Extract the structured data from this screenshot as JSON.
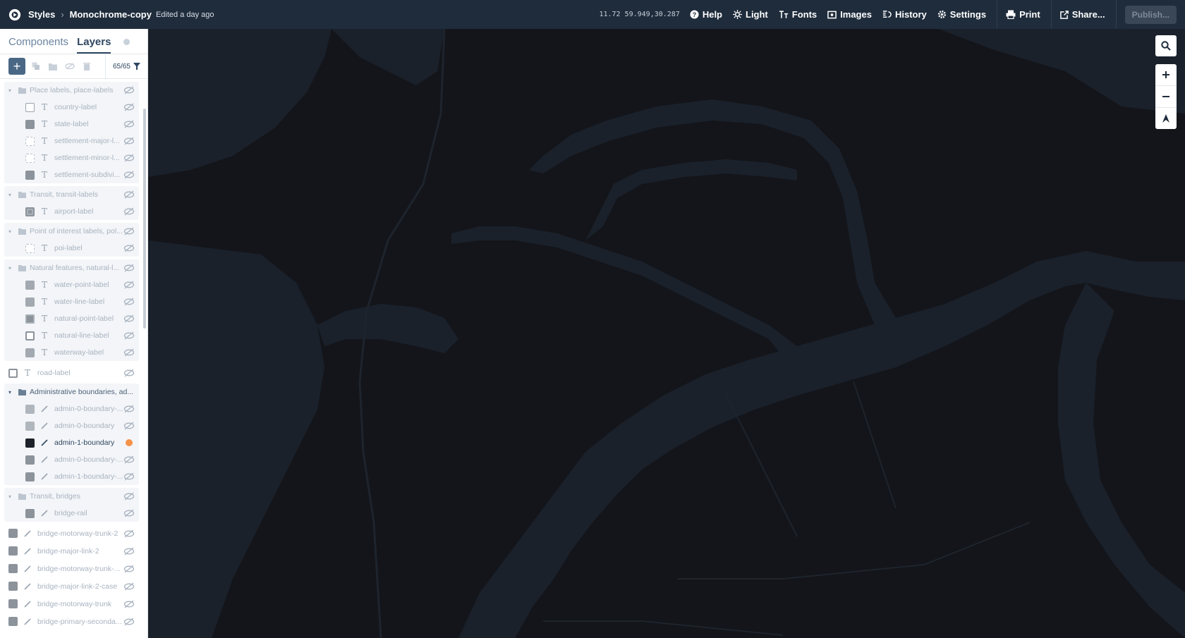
{
  "topbar": {
    "styles_label": "Styles",
    "style_name": "Monochrome-copy",
    "edited": "Edited a day ago",
    "coords": "11.72 59.949,30.287",
    "help": "Help",
    "light": "Light",
    "fonts": "Fonts",
    "images": "Images",
    "history": "History",
    "settings": "Settings",
    "print": "Print",
    "share": "Share...",
    "publish": "Publish..."
  },
  "sidebar": {
    "tabs": {
      "components": "Components",
      "layers": "Layers"
    },
    "layer_count": "65/65"
  },
  "layers": {
    "place_group": {
      "label": "Place labels, place-labels",
      "items": [
        "country-label",
        "state-label",
        "settlement-major-l...",
        "settlement-minor-l...",
        "settlement-subdivi..."
      ]
    },
    "transit_group": {
      "label": "Transit, transit-labels",
      "items": [
        "airport-label"
      ]
    },
    "poi_group": {
      "label": "Point of interest labels, pol...",
      "items": [
        "poi-label"
      ]
    },
    "natural_group": {
      "label": "Natural features, natural-l...",
      "items": [
        "water-point-label",
        "water-line-label",
        "natural-point-label",
        "natural-line-label",
        "waterway-label"
      ]
    },
    "road_label": "road-label",
    "admin_group": {
      "label": "Administrative boundaries, ad...",
      "items": [
        "admin-0-boundary-...",
        "admin-0-boundary",
        "admin-1-boundary",
        "admin-0-boundary-...",
        "admin-1-boundary-..."
      ]
    },
    "bridges_group": {
      "label": "Transit, bridges",
      "items": [
        "bridge-rail"
      ]
    },
    "top_items": [
      "bridge-motorway-trunk-2",
      "bridge-major-link-2",
      "bridge-motorway-trunk-...",
      "bridge-major-link-2-case",
      "bridge-motorway-trunk",
      "bridge-primary-seconda..."
    ]
  },
  "colors": {
    "topbar": "#1f2c3c",
    "map_bg": "#13151a",
    "map_water": "#1b212b",
    "selected_dot": "#f5924a",
    "accent": "#4a6886"
  }
}
